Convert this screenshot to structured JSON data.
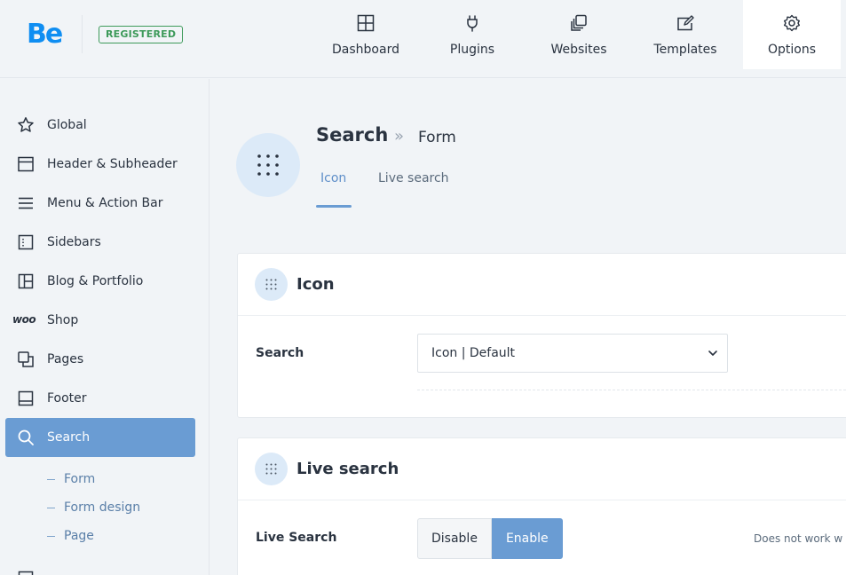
{
  "header": {
    "logo": "Be",
    "badge": "REGISTERED",
    "nav": [
      {
        "label": "Dashboard",
        "icon": "dashboard-icon"
      },
      {
        "label": "Plugins",
        "icon": "plug-icon"
      },
      {
        "label": "Websites",
        "icon": "websites-icon"
      },
      {
        "label": "Templates",
        "icon": "templates-icon"
      },
      {
        "label": "Options",
        "icon": "gear-icon",
        "active": true
      }
    ]
  },
  "sidebar": {
    "items": [
      {
        "label": "Global",
        "icon": "star-icon"
      },
      {
        "label": "Header & Subheader",
        "icon": "header-layout-icon"
      },
      {
        "label": "Menu & Action Bar",
        "icon": "menu-icon"
      },
      {
        "label": "Sidebars",
        "icon": "sidebar-layout-icon"
      },
      {
        "label": "Blog & Portfolio",
        "icon": "grid-layout-icon"
      },
      {
        "label": "Shop",
        "icon": "woo-icon",
        "icon_text": "woo"
      },
      {
        "label": "Pages",
        "icon": "pages-icon"
      },
      {
        "label": "Footer",
        "icon": "footer-layout-icon"
      },
      {
        "label": "Search",
        "icon": "search-icon",
        "active": true
      }
    ],
    "subitems": [
      {
        "label": "Form"
      },
      {
        "label": "Form design"
      },
      {
        "label": "Page"
      }
    ]
  },
  "main": {
    "title": "Search",
    "breadcrumb_sep": "»",
    "breadcrumb_current": "Form",
    "tabs": [
      {
        "label": "Icon",
        "active": true
      },
      {
        "label": "Live search"
      }
    ],
    "sections": [
      {
        "title": "Icon",
        "field_label": "Search",
        "select_value": "Icon | Default"
      },
      {
        "title": "Live search",
        "field_label": "Live Search",
        "options": [
          "Disable",
          "Enable"
        ],
        "selected": "Enable",
        "hint": "Does not work w"
      }
    ]
  },
  "colors": {
    "accent": "#6a9cd3",
    "brand": "#0f8ef2",
    "badge": "#3d9a5a",
    "background": "#f1f4f7"
  }
}
